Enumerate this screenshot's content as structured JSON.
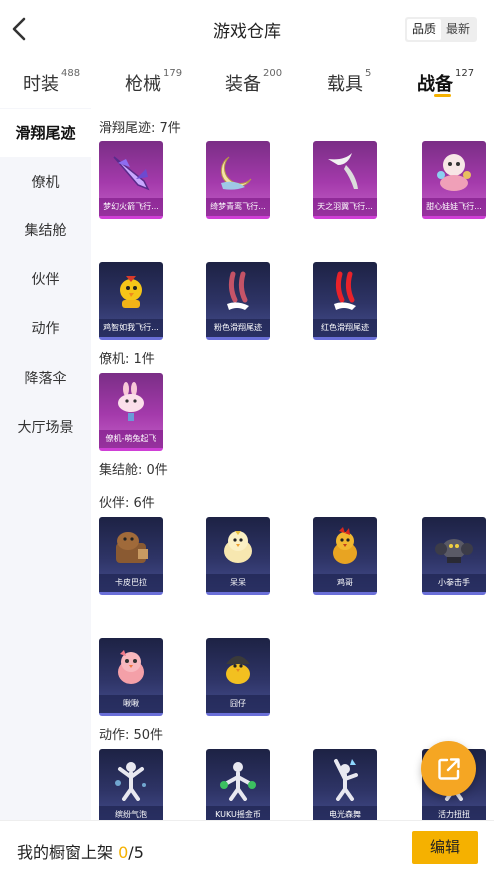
{
  "header": {
    "title": "游戏仓库",
    "sort_options": [
      "品质",
      "最新"
    ],
    "sort_active": "品质"
  },
  "tabs": [
    {
      "label": "时装",
      "count": "488"
    },
    {
      "label": "枪械",
      "count": "179"
    },
    {
      "label": "装备",
      "count": "200"
    },
    {
      "label": "载具",
      "count": "5"
    },
    {
      "label": "战备",
      "count": "127",
      "active": true
    }
  ],
  "sidebar": {
    "items": [
      "滑翔尾迹",
      "僚机",
      "集结舱",
      "伙伴",
      "动作",
      "降落伞",
      "大厅场景"
    ],
    "active": "滑翔尾迹"
  },
  "sections": [
    {
      "title": "滑翔尾迹: 7件",
      "items": [
        {
          "name": "梦幻火箭飞行...",
          "style": "purple",
          "icon": "rocket-icon"
        },
        {
          "name": "绮梦青鸾飞行...",
          "style": "purple",
          "icon": "moon-icon"
        },
        {
          "name": "天之羽翼飞行...",
          "style": "purple",
          "icon": "wing-icon"
        },
        {
          "name": "甜心娃娃飞行...",
          "style": "purple",
          "icon": "doll-icon"
        },
        {
          "name": "鸡智如我飞行...",
          "style": "blue",
          "icon": "chick-icon"
        },
        {
          "name": "粉色滑翔尾迹",
          "style": "blue",
          "icon": "pink-trail-icon"
        },
        {
          "name": "红色滑翔尾迹",
          "style": "blue",
          "icon": "red-trail-icon"
        }
      ]
    },
    {
      "title": "僚机: 1件",
      "items": [
        {
          "name": "僚机-萌兔起飞",
          "style": "purple",
          "icon": "bunny-icon"
        }
      ]
    },
    {
      "title": "集结舱: 0件",
      "items": []
    },
    {
      "title": "伙伴: 6件",
      "items": [
        {
          "name": "卡皮巴拉",
          "style": "blue",
          "icon": "capybara-icon"
        },
        {
          "name": "呆呆",
          "style": "blue",
          "icon": "chick-icon"
        },
        {
          "name": "鸡哥",
          "style": "blue",
          "icon": "rooster-icon"
        },
        {
          "name": "小拳击手",
          "style": "blue",
          "icon": "boxer-icon"
        },
        {
          "name": "啾啾",
          "style": "blue",
          "icon": "pink-bird-icon"
        },
        {
          "name": "囧仔",
          "style": "blue",
          "icon": "helmet-chick-icon"
        }
      ]
    },
    {
      "title": "动作: 50件",
      "items": [
        {
          "name": "缤纷气泡",
          "style": "blue",
          "icon": "dance-icon"
        },
        {
          "name": "KUKU摇金币",
          "style": "blue",
          "icon": "dance-icon"
        },
        {
          "name": "电光森舞",
          "style": "blue",
          "icon": "dance-icon"
        },
        {
          "name": "活力扭扭",
          "style": "blue",
          "icon": "dance-icon"
        }
      ]
    }
  ],
  "bottom": {
    "label": "我的橱窗上架",
    "count_current": "0",
    "count_total": "/5",
    "edit_label": "编辑"
  },
  "colors": {
    "accent": "#f5b100",
    "fab": "#f5a623",
    "card_purple": "#a43aab",
    "card_blue": "#2e3466"
  }
}
